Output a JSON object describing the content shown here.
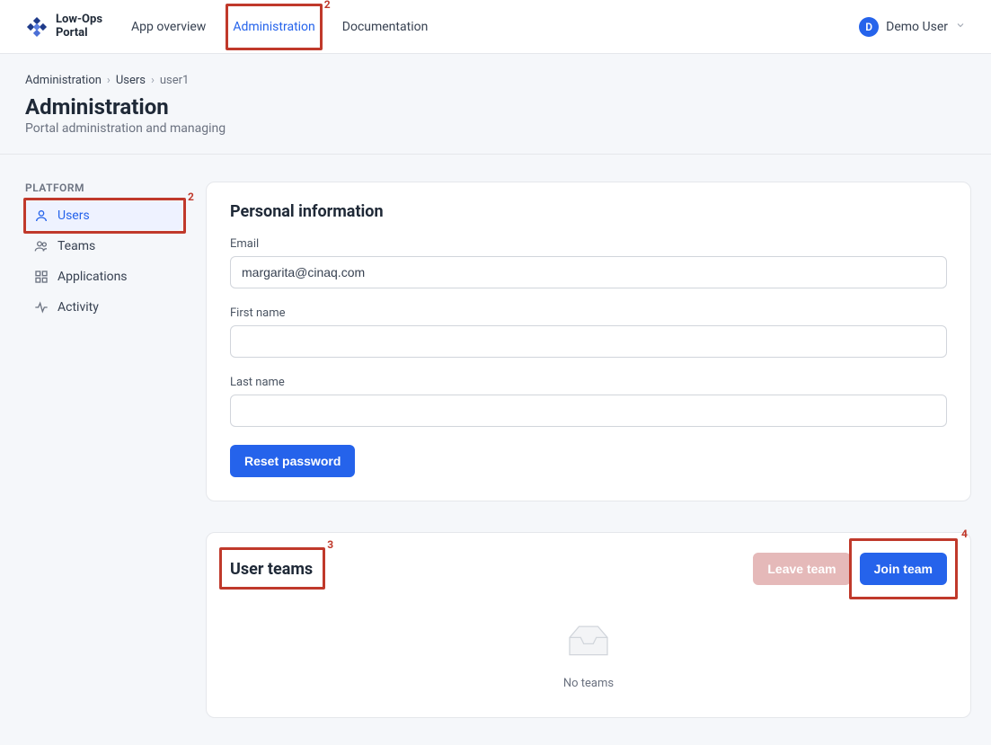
{
  "app": {
    "name_line1": "Low-Ops",
    "name_line2": "Portal"
  },
  "nav": {
    "items": [
      {
        "label": "App overview"
      },
      {
        "label": "Administration"
      },
      {
        "label": "Documentation"
      }
    ]
  },
  "user": {
    "initial": "D",
    "name": "Demo User"
  },
  "breadcrumb": {
    "items": [
      {
        "label": "Administration"
      },
      {
        "label": "Users"
      },
      {
        "label": "user1"
      }
    ]
  },
  "page": {
    "title": "Administration",
    "subtitle": "Portal administration and managing"
  },
  "sidebar": {
    "section_label": "PLATFORM",
    "items": [
      {
        "label": "Users"
      },
      {
        "label": "Teams"
      },
      {
        "label": "Applications"
      },
      {
        "label": "Activity"
      }
    ]
  },
  "personal": {
    "card_title": "Personal information",
    "email_label": "Email",
    "email_value": "margarita@cinaq.com",
    "first_name_label": "First name",
    "first_name_value": "",
    "last_name_label": "Last name",
    "last_name_value": "",
    "reset_password_label": "Reset password"
  },
  "teams": {
    "card_title": "User teams",
    "leave_label": "Leave team",
    "join_label": "Join team",
    "empty_text": "No teams"
  },
  "annotations": {
    "two_a": "2",
    "two_b": "2",
    "three": "3",
    "four": "4"
  }
}
